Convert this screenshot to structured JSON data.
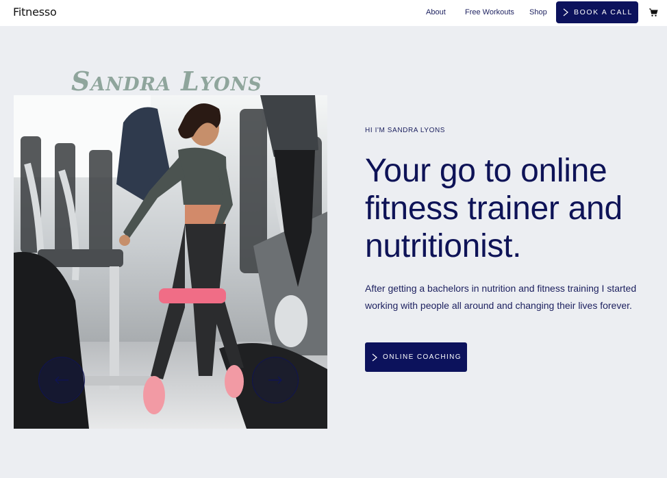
{
  "header": {
    "logo": "Fitnesso",
    "nav": [
      "About",
      "Free Workouts",
      "Shop"
    ],
    "cta_label": "BOOK A CALL",
    "cart_icon": "cart-icon"
  },
  "hero": {
    "script_name": "Sandra Lyons",
    "eyebrow": "HI I'M SANDRA LYONS",
    "headline": "Your go to online fitness trainer and nutritionist.",
    "bio": "After getting a bachelors in nutrition and fitness training I started working with people all around and changing their lives forever.",
    "cta_label": "ONLINE COACHING",
    "image_alt": "Woman in gym doing resistance band exercise",
    "prev_icon": "arrow-left-icon",
    "next_icon": "arrow-right-icon"
  },
  "colors": {
    "brand_navy": "#0c125c",
    "background": "#eceef2",
    "script_green": "#8fa59c"
  }
}
